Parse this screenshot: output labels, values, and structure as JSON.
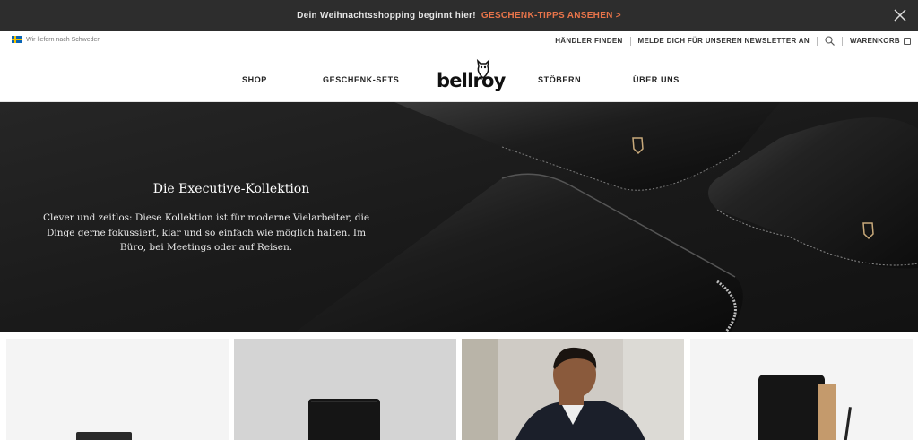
{
  "promo": {
    "text": "Dein Weihnachtsshopping beginnt hier!",
    "link": "GESCHENK-TIPPS ANSEHEN >",
    "close_icon": "close-icon"
  },
  "utility": {
    "shipping": "Wir liefern nach Schweden",
    "flag_icon": "sweden-flag-icon",
    "dealer": "HÄNDLER FINDEN",
    "newsletter": "MELDE DICH FÜR UNSEREN NEWSLETTER AN",
    "search_icon": "search-icon",
    "cart": "WARENKORB",
    "cart_icon": "shopping-bag-icon"
  },
  "nav": {
    "items": [
      "SHOP",
      "GESCHENK-SETS",
      "STÖBERN",
      "ÜBER UNS"
    ],
    "logo": "bellroy"
  },
  "hero": {
    "title": "Die Executive-Kollektion",
    "description": "Clever und zeitlos: Diese Kollektion ist für moderne Vielarbeiter, die Dinge gerne fokussiert, klar und so einfach wie möglich halten. Im Büro, bei Meetings oder auf Reisen."
  },
  "colors": {
    "promo_bg": "#2d2d2d",
    "promo_link": "#e8744a",
    "hero_bg": "#1c1c1c"
  }
}
